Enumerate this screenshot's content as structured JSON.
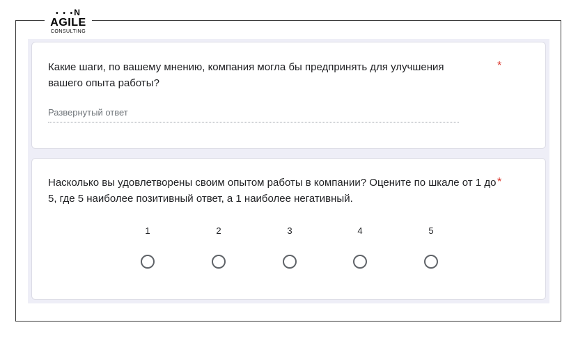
{
  "logo": {
    "top_text": "N",
    "main_text": "AGILE",
    "sub_text": "CONSULTING"
  },
  "questions": [
    {
      "title": "Какие шаги, по вашему мнению, компания могла бы предпринять для улучшения вашего опыта работы?",
      "required_mark": "*",
      "type": "paragraph",
      "placeholder": "Развернутый ответ"
    },
    {
      "title": "Насколько вы удовлетворены своим опытом работы в компании? Оцените по шкале от 1 до 5, где 5 наиболее позитивный ответ, а 1 наиболее негативный.",
      "required_mark": "*",
      "type": "linear-scale",
      "options": [
        "1",
        "2",
        "3",
        "4",
        "5"
      ],
      "selected": null
    }
  ],
  "colors": {
    "form_background": "#eeeef7",
    "required": "#d93025",
    "radio_border": "#5f6368"
  }
}
